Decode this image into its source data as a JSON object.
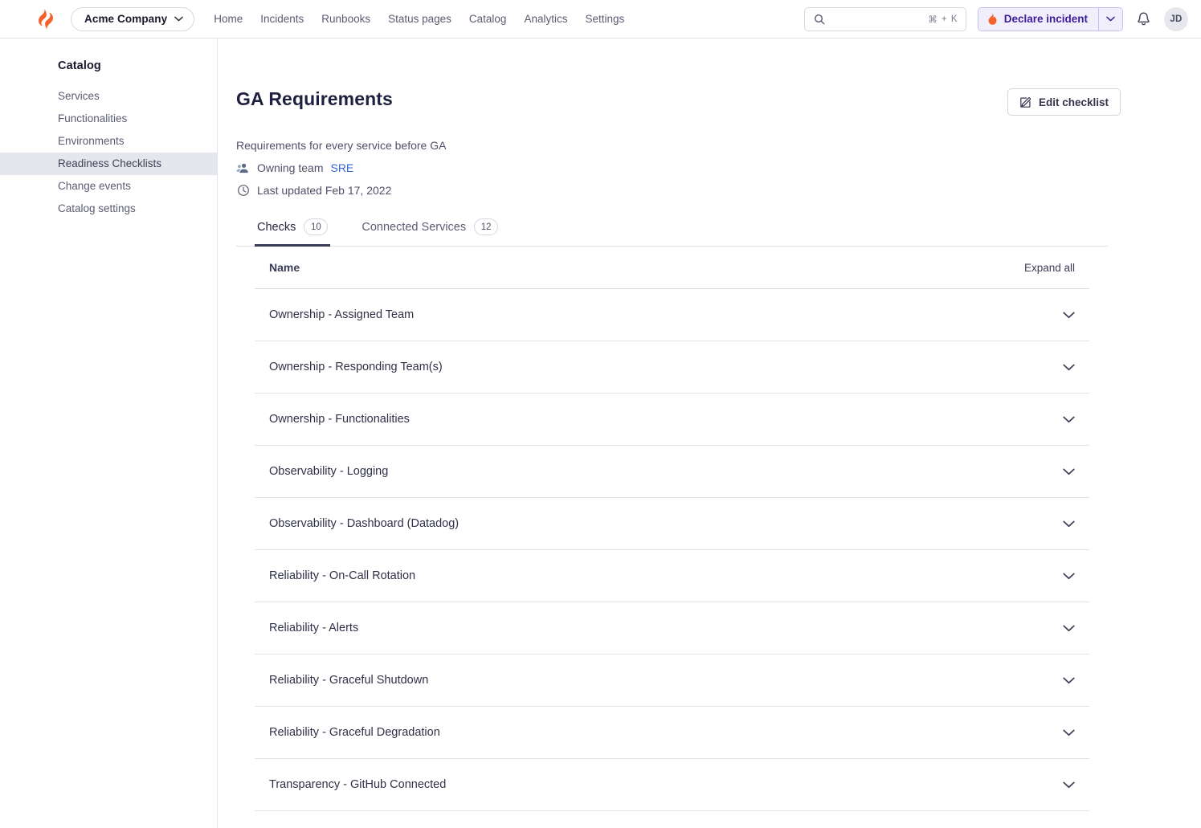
{
  "topbar": {
    "logo_icon": "firehydrant-logo-icon",
    "org_switcher": {
      "label": "Acme Company",
      "icon": "chevron-down-icon"
    },
    "nav_items": [
      {
        "label": "Home"
      },
      {
        "label": "Incidents"
      },
      {
        "label": "Runbooks"
      },
      {
        "label": "Status pages"
      },
      {
        "label": "Catalog"
      },
      {
        "label": "Analytics"
      },
      {
        "label": "Settings"
      }
    ],
    "search": {
      "icon": "search-icon",
      "placeholder": "",
      "value": "",
      "shortcut_modifier": "⌘",
      "shortcut_sep": "+",
      "shortcut_key": "K"
    },
    "declare_incident": {
      "label": "Declare incident",
      "icon": "flame-icon",
      "caret_icon": "chevron-down-icon",
      "bg_color": "#f2effd",
      "text_color": "#3a1d9c",
      "border_color": "#c9bdf5"
    },
    "notifications": {
      "icon": "bell-icon"
    },
    "avatar": {
      "initials": "JD"
    }
  },
  "sidebar": {
    "heading": "Catalog",
    "items": [
      {
        "label": "Services",
        "active": false
      },
      {
        "label": "Functionalities",
        "active": false
      },
      {
        "label": "Environments",
        "active": false
      },
      {
        "label": "Readiness Checklists",
        "active": true
      },
      {
        "label": "Change events",
        "active": false
      },
      {
        "label": "Catalog settings",
        "active": false
      }
    ]
  },
  "page": {
    "title": "GA Requirements",
    "edit_button": {
      "label": "Edit checklist",
      "icon": "pencil-edit-icon"
    },
    "subtitle": "Requirements for every service before GA",
    "owning_team": {
      "icon": "users-icon",
      "label": "Owning team",
      "value": "SRE",
      "value_color": "#3066d6"
    },
    "last_updated": {
      "icon": "clock-icon",
      "text": "Last updated Feb 17, 2022"
    }
  },
  "tabs": [
    {
      "label": "Checks",
      "count": "10",
      "active": true
    },
    {
      "label": "Connected Services",
      "count": "12",
      "active": false
    }
  ],
  "table": {
    "header": {
      "name": "Name",
      "expand_all": "Expand all"
    },
    "row_chevron_icon": "chevron-down-icon",
    "rows": [
      {
        "name": "Ownership - Assigned Team"
      },
      {
        "name": "Ownership - Responding Team(s)"
      },
      {
        "name": "Ownership - Functionalities"
      },
      {
        "name": "Observability - Logging"
      },
      {
        "name": "Observability - Dashboard (Datadog)"
      },
      {
        "name": "Reliability - On-Call Rotation"
      },
      {
        "name": "Reliability - Alerts"
      },
      {
        "name": "Reliability - Graceful Shutdown"
      },
      {
        "name": "Reliability - Graceful Degradation"
      },
      {
        "name": "Transparency - GitHub Connected"
      }
    ]
  }
}
